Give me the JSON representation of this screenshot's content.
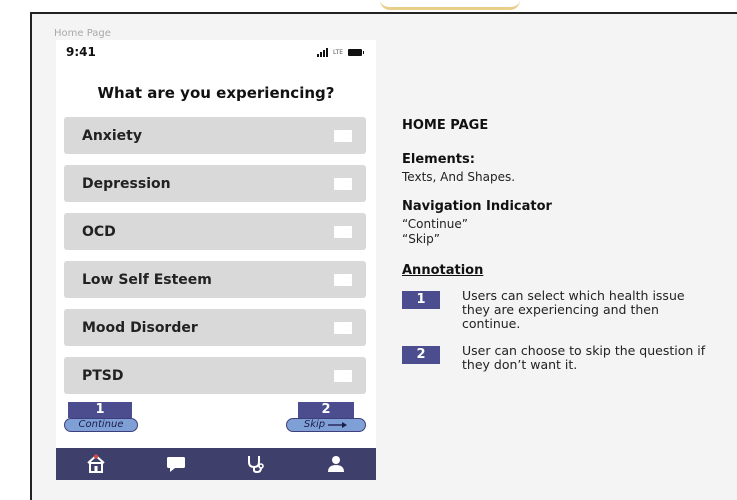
{
  "frame_label": "Home Page",
  "status_bar": {
    "time": "9:41",
    "network": "LTE"
  },
  "question": "What are you experiencing?",
  "options": [
    {
      "label": "Anxiety"
    },
    {
      "label": "Depression"
    },
    {
      "label": "OCD"
    },
    {
      "label": "Low Self Esteem"
    },
    {
      "label": "Mood Disorder"
    },
    {
      "label": "PTSD"
    }
  ],
  "continue": {
    "badge": "1",
    "label": "Continue"
  },
  "skip": {
    "badge": "2",
    "label": "Skip"
  },
  "tabbar": {
    "icons": [
      "home-icon",
      "chat-icon",
      "stethoscope-icon",
      "profile-icon"
    ]
  },
  "notes": {
    "title": "HOME PAGE",
    "elements_heading": "Elements:",
    "elements_body": "Texts, And Shapes.",
    "navigation_heading": "Navigation Indicator",
    "navigation_items": [
      "“Continue”",
      "“Skip”"
    ],
    "annotation_heading": "Annotation",
    "annotations": [
      {
        "number": "1",
        "text": "Users can select which health issue they are experiencing and then continue."
      },
      {
        "number": "2",
        "text": "User can choose to skip the question if they don’t want it."
      }
    ]
  },
  "colors": {
    "accent": "#4b4d8f",
    "tabbar": "#3f3f6b",
    "option_bg": "#d9d9d9",
    "pill": "#7fa0d6"
  }
}
